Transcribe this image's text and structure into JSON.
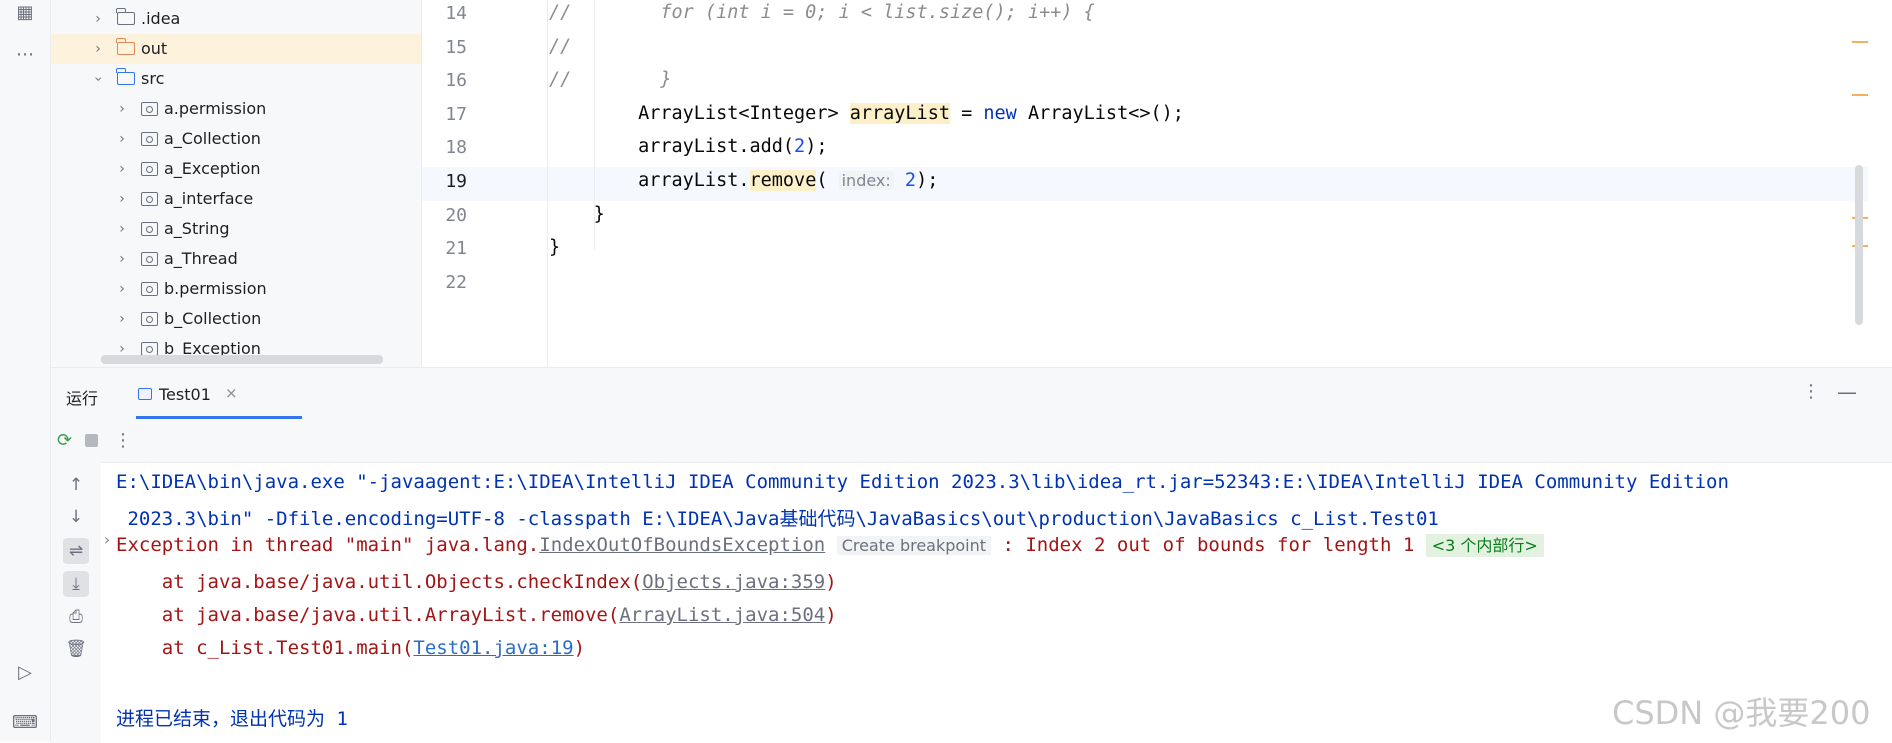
{
  "activity_bar": {
    "icons": [
      "structure-icon",
      "more-icon",
      "run-icon",
      "terminal-icon"
    ]
  },
  "project_tree": {
    "items": [
      {
        "label": ".idea",
        "type": "folder",
        "expanded": false
      },
      {
        "label": "out",
        "type": "folder-excluded",
        "expanded": false,
        "selected": true
      },
      {
        "label": "src",
        "type": "folder-source",
        "expanded": true
      },
      {
        "label": "a.permission",
        "type": "package"
      },
      {
        "label": "a_Collection",
        "type": "package"
      },
      {
        "label": "a_Exception",
        "type": "package"
      },
      {
        "label": "a_interface",
        "type": "package"
      },
      {
        "label": "a_String",
        "type": "package"
      },
      {
        "label": "a_Thread",
        "type": "package"
      },
      {
        "label": "b.permission",
        "type": "package"
      },
      {
        "label": "b_Collection",
        "type": "package"
      },
      {
        "label": "b_Exception",
        "type": "package"
      }
    ]
  },
  "editor": {
    "line_numbers": [
      "14",
      "15",
      "16",
      "17",
      "18",
      "19",
      "20",
      "21",
      "22"
    ],
    "current_line": "19",
    "lines": {
      "l14_comment": "//",
      "l14_code": "for (int i = 0; i < list.size(); i++) {",
      "l15_comment": "//",
      "l16_comment": "//",
      "l16_code": "}",
      "l17_type": "ArrayList<Integer> ",
      "l17_var": "arrayList",
      "l17_eq": " = ",
      "l17_new": "new",
      "l17_rest": " ArrayList<>();",
      "l18_a": "arrayList.add(",
      "l18_num": "2",
      "l18_b": ");",
      "l19_a": "arrayList.",
      "l19_method": "remove",
      "l19_paren": "(",
      "l19_hint": "index:",
      "l19_num": "2",
      "l19_b": ");",
      "l20": "}",
      "l21": "}"
    }
  },
  "run_window": {
    "title": "运行",
    "tab_label": "Test01",
    "tab_close": "×",
    "more": "⋮",
    "hide": "—"
  },
  "console": {
    "cmd_line1": "E:\\IDEA\\bin\\java.exe \"-javaagent:E:\\IDEA\\IntelliJ IDEA Community Edition 2023.3\\lib\\idea_rt.jar=52343:E:\\IDEA\\IntelliJ IDEA Community Edition",
    "cmd_line2": " 2023.3\\bin\" -Dfile.encoding=UTF-8 -classpath E:\\IDEA\\Java基础代码\\JavaBasics\\out\\production\\JavaBasics c_List.Test01",
    "exception_prefix": "Exception in thread \"main\" java.lang.",
    "exception_class": "IndexOutOfBoundsException",
    "create_breakpoint": "Create breakpoint",
    "exception_message": " : Index 2 out of bounds for length 1 ",
    "collapsed_frames": "<3 个内部行>",
    "stack": [
      {
        "prefix": "    at java.base/java.util.Objects.checkIndex(",
        "link": "Objects.java:359",
        "suffix": ")"
      },
      {
        "prefix": "    at java.base/java.util.ArrayList.remove(",
        "link": "ArrayList.java:504",
        "suffix": ")"
      },
      {
        "prefix": "    at c_List.Test01.main(",
        "link": "Test01.java:19",
        "suffix": ")"
      }
    ],
    "exit_message": "进程已结束，退出代码为 1"
  },
  "watermark": "CSDN @我要200"
}
